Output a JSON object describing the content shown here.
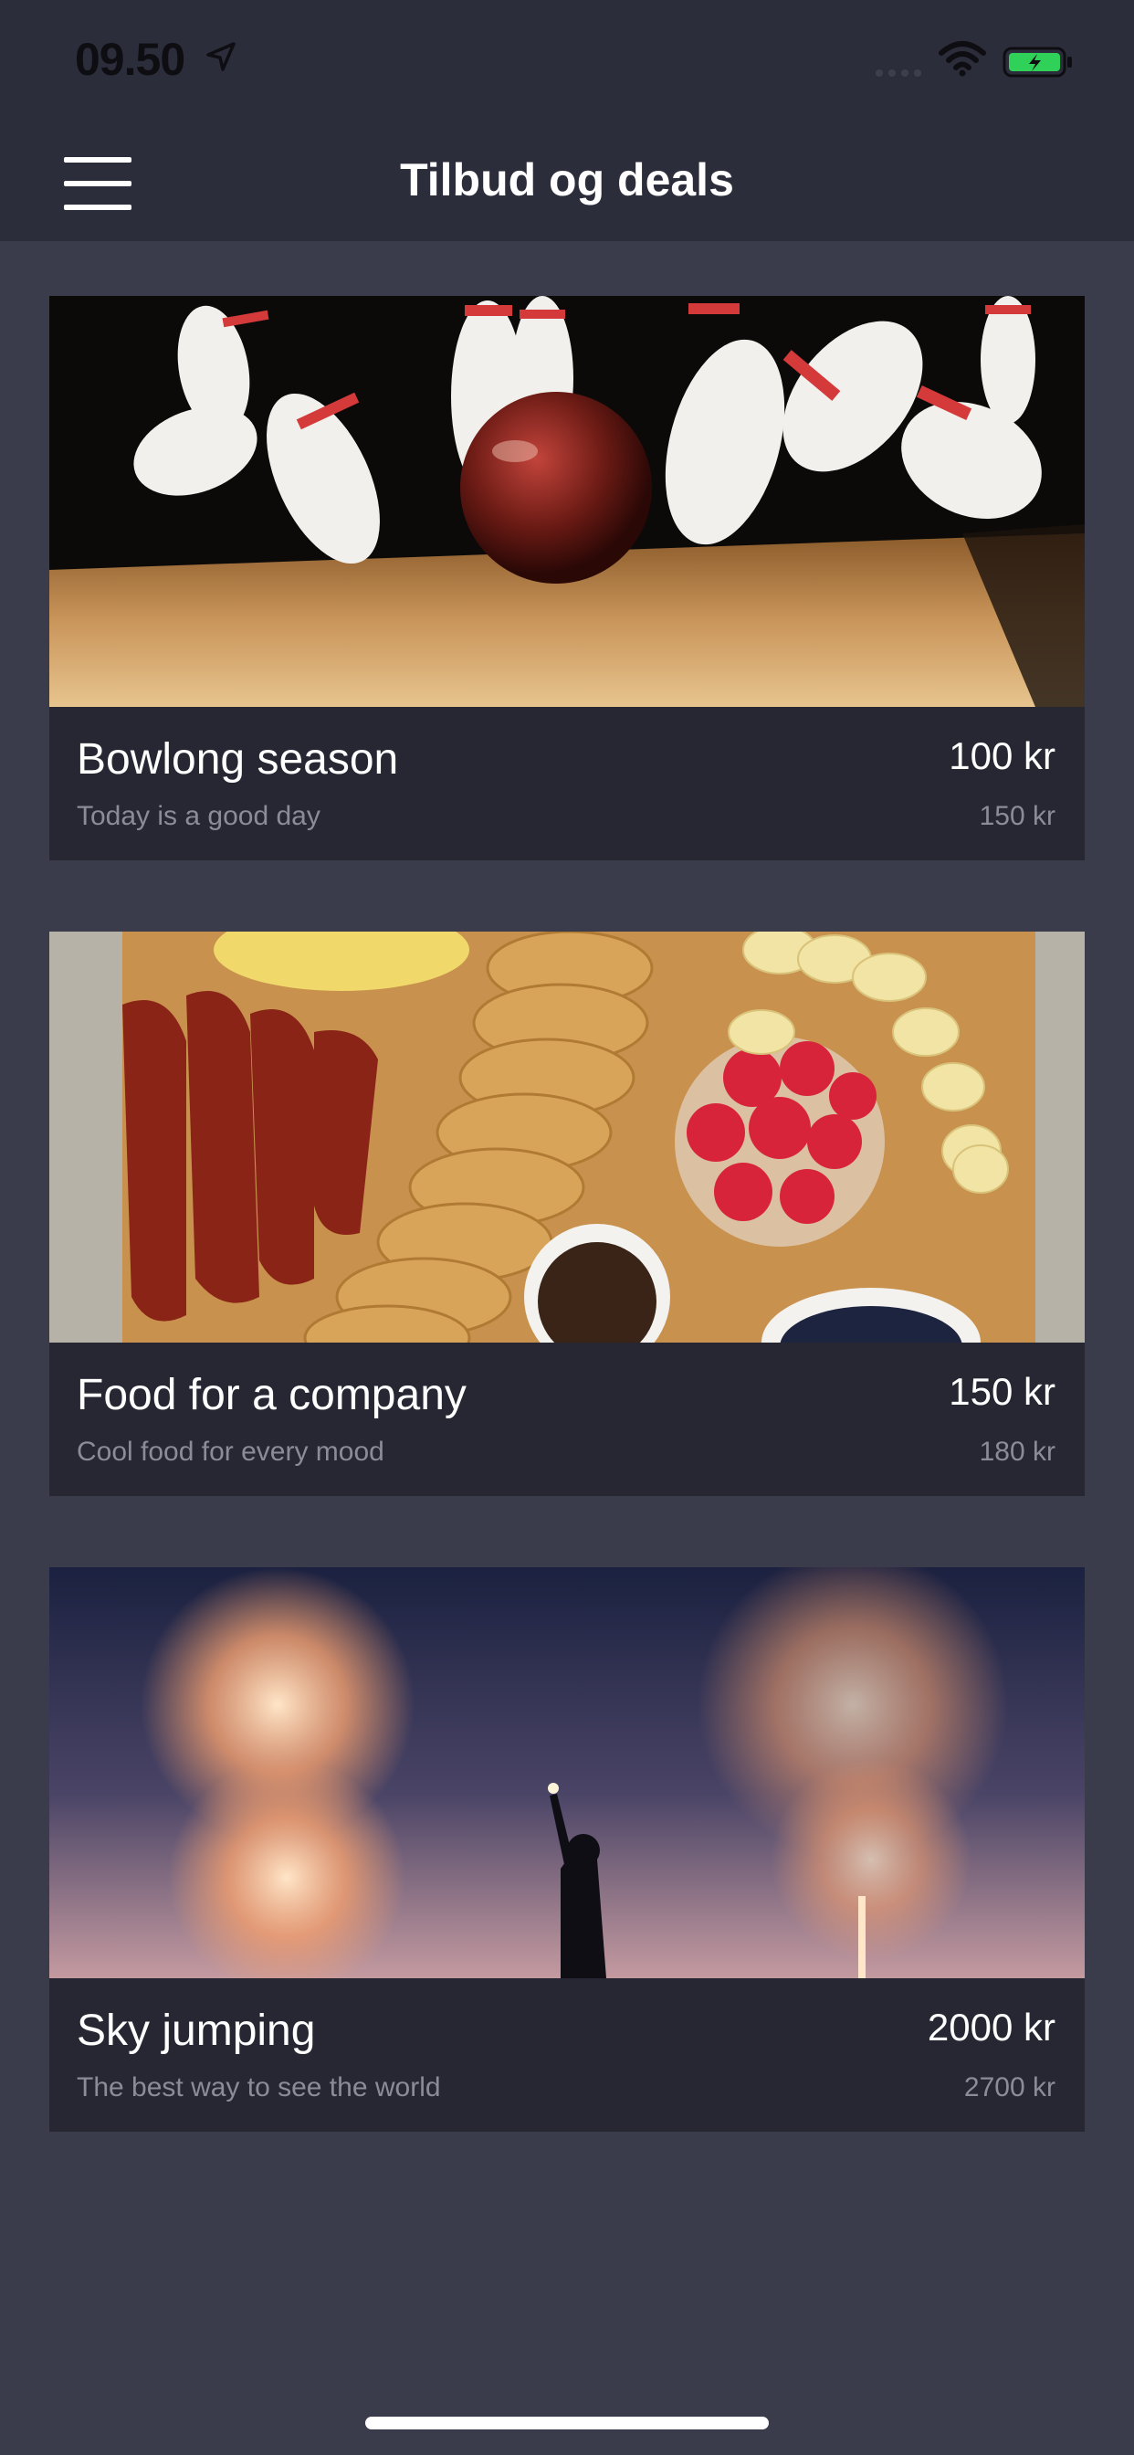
{
  "status_bar": {
    "time": "09.50",
    "icons": [
      "location-arrow-icon",
      "signal-icon",
      "wifi-icon",
      "battery-charging-icon"
    ],
    "battery_color": "#30d158"
  },
  "nav": {
    "title": "Tilbud og deals",
    "menu_icon": "hamburger-menu-icon"
  },
  "deals": [
    {
      "title": "Bowlong season",
      "subtitle": "Today is a good day",
      "price": "100 kr",
      "old_price": "150 kr",
      "image": "bowling-pins-image"
    },
    {
      "title": "Food for a company",
      "subtitle": "Cool food for every mood",
      "price": "150 kr",
      "old_price": "180 kr",
      "image": "breakfast-board-image"
    },
    {
      "title": "Sky jumping",
      "subtitle": "The best way to see the world",
      "price": "2000 kr",
      "old_price": "2700 kr",
      "image": "fireworks-image"
    }
  ],
  "colors": {
    "background": "#3a3b4b",
    "header": "#2c2d3b",
    "card": "#262733",
    "secondary_text": "#8b8c98"
  }
}
